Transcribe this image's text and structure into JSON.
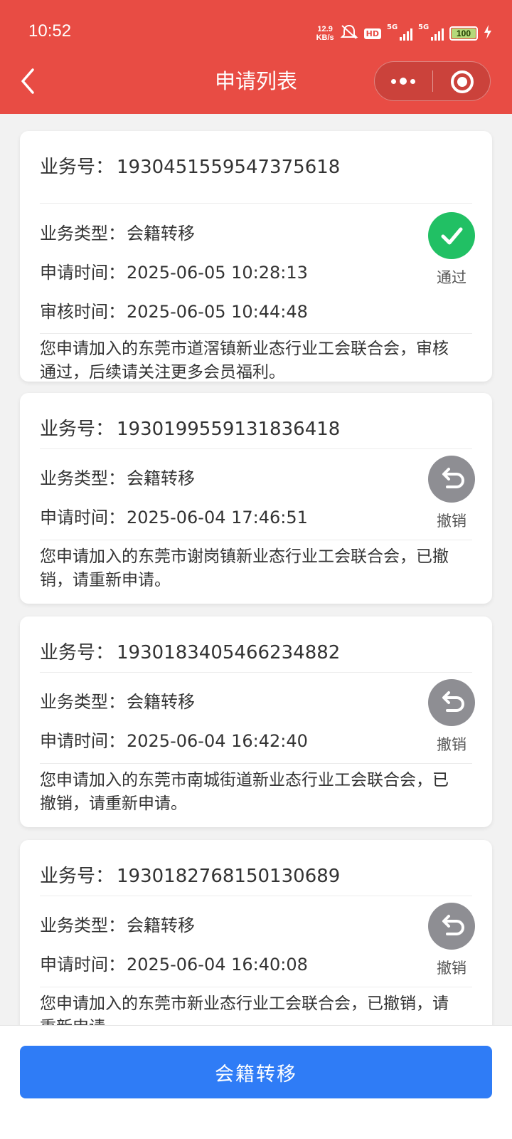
{
  "status_bar": {
    "time": "10:52",
    "net_speed_value": "12.9",
    "net_speed_unit": "KB/s",
    "hd_label": "HD",
    "sim1_label": "5G",
    "sim2_label": "5G",
    "battery": "100"
  },
  "nav": {
    "title": "申请列表"
  },
  "labels": {
    "biz_no": "业务号：",
    "biz_type": "业务类型：",
    "apply_time": "申请时间：",
    "review_time": "审核时间："
  },
  "applications": [
    {
      "biz_no": "1930451559547375618",
      "biz_type": "会籍转移",
      "apply_time": "2025-06-05 10:28:13",
      "review_time": "2025-06-05 10:44:48",
      "status": "通过",
      "status_icon": "check-icon",
      "status_color": "#21c064",
      "message": "您申请加入的东莞市道滘镇新业态行业工会联合会，审核通过，后续请关注更多会员福利。"
    },
    {
      "biz_no": "1930199559131836418",
      "biz_type": "会籍转移",
      "apply_time": "2025-06-04 17:46:51",
      "status": "撤销",
      "status_icon": "undo-icon",
      "status_color": "#8e8e93",
      "message": "您申请加入的东莞市谢岗镇新业态行业工会联合会，已撤销，请重新申请。"
    },
    {
      "biz_no": "1930183405466234882",
      "biz_type": "会籍转移",
      "apply_time": "2025-06-04 16:42:40",
      "status": "撤销",
      "status_icon": "undo-icon",
      "status_color": "#8e8e93",
      "message": "您申请加入的东莞市南城街道新业态行业工会联合会，已撤销，请重新申请。"
    },
    {
      "biz_no": "1930182768150130689",
      "biz_type": "会籍转移",
      "apply_time": "2025-06-04 16:40:08",
      "status": "撤销",
      "status_icon": "undo-icon",
      "status_color": "#8e8e93",
      "message": "您申请加入的东莞市新业态行业工会联合会，已撤销，请重新申请。"
    }
  ],
  "bottom": {
    "button_label": "会籍转移"
  }
}
